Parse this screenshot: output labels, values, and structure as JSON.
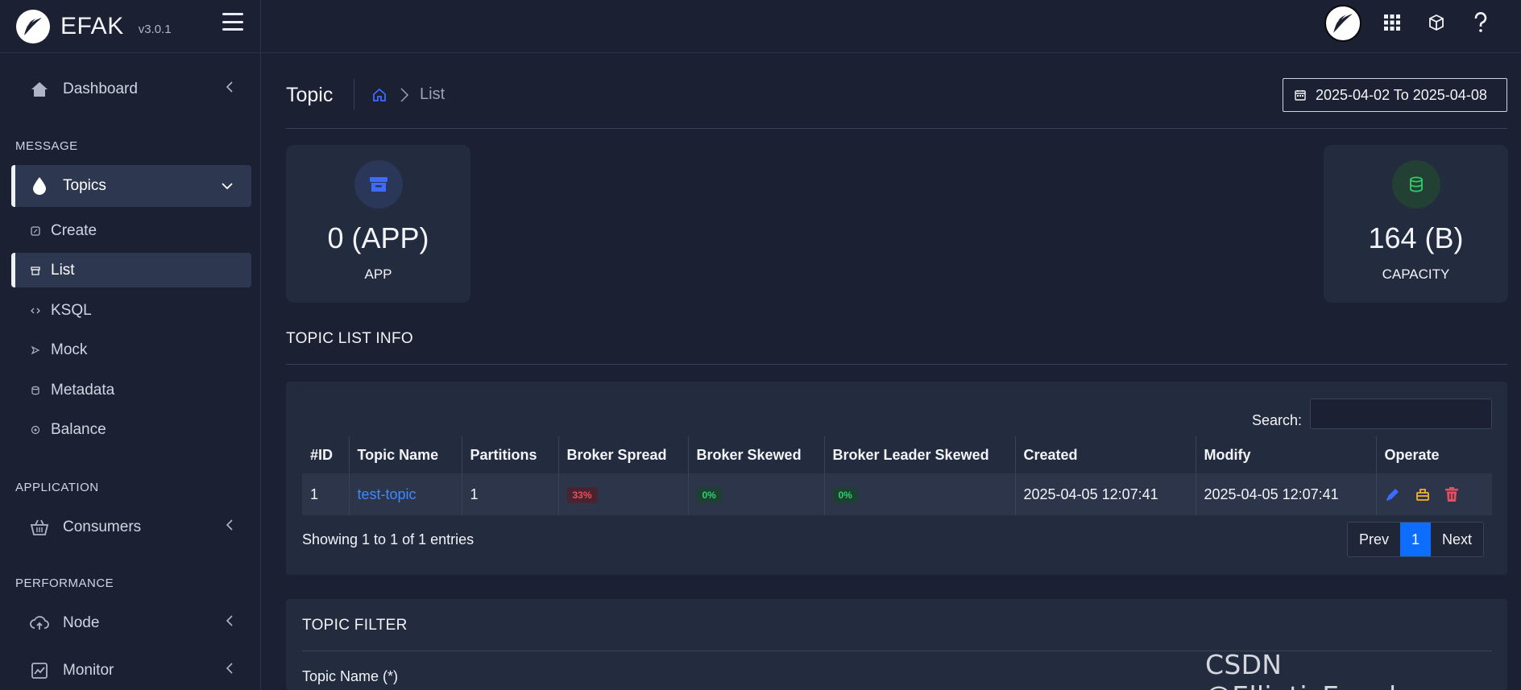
{
  "brand": {
    "name": "EFAK",
    "version": "v3.0.1"
  },
  "sidebar": {
    "dashboard": "Dashboard",
    "section_message": "MESSAGE",
    "topics": "Topics",
    "sub_items": [
      "Create",
      "List",
      "KSQL",
      "Mock",
      "Metadata",
      "Balance"
    ],
    "section_application": "APPLICATION",
    "consumers": "Consumers",
    "section_performance": "PERFORMANCE",
    "node": "Node",
    "monitor": "Monitor"
  },
  "page": {
    "title": "Topic",
    "breadcrumb_current": "List",
    "date_range": "2025-04-02 To 2025-04-08"
  },
  "stats": {
    "app": {
      "value": "0 (APP)",
      "label": "APP",
      "color": "#3d6bfd"
    },
    "capacity": {
      "value": "164 (B)",
      "label": "CAPACITY",
      "color": "#2fcf6b"
    }
  },
  "topic_list": {
    "title": "TOPIC LIST INFO",
    "search_label": "Search:",
    "columns": [
      "#ID",
      "Topic Name",
      "Partitions",
      "Broker Spread",
      "Broker Skewed",
      "Broker Leader Skewed",
      "Created",
      "Modify",
      "Operate"
    ],
    "rows": [
      {
        "id": "1",
        "name": "test-topic",
        "partitions": "1",
        "broker_spread": "33%",
        "broker_skewed": "0%",
        "broker_leader_skewed": "0%",
        "created": "2025-04-05 12:07:41",
        "modify": "2025-04-05 12:07:41"
      }
    ],
    "showing": "Showing 1 to 1 of 1 entries",
    "pager": {
      "prev": "Prev",
      "current": "1",
      "next": "Next"
    }
  },
  "topic_filter": {
    "title": "TOPIC FILTER",
    "field_label": "Topic Name (*)"
  },
  "watermark": "CSDN @EllipticEnvelope"
}
